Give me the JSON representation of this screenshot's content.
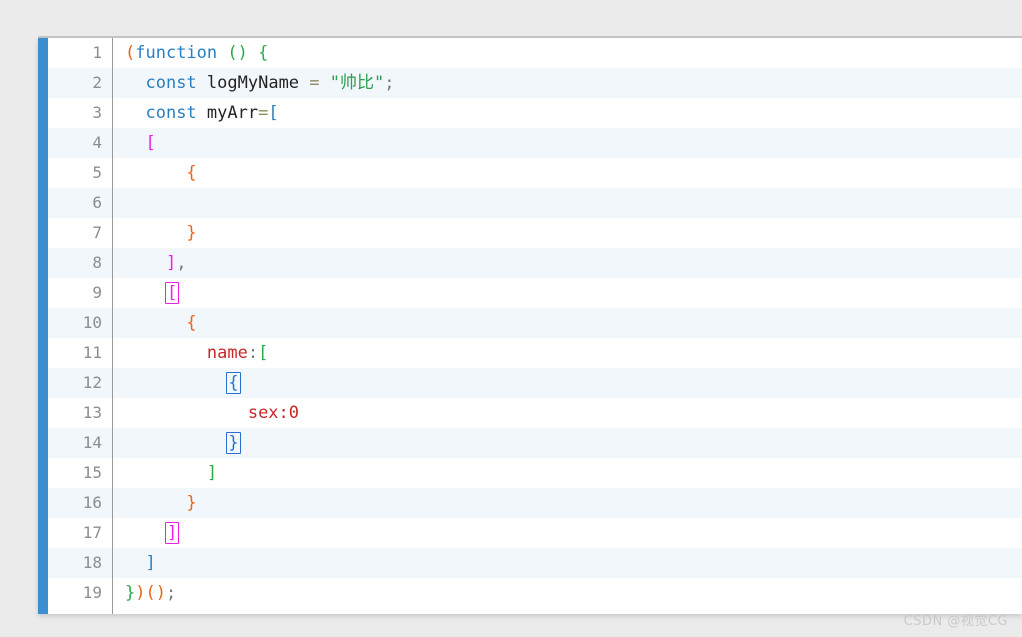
{
  "editor": {
    "accent_color": "#3b8fce",
    "background": "#ffffff",
    "alt_row_background": "#f2f7fb",
    "gutter_separator_color": "#9a9a9a",
    "line_count": 19,
    "lines": [
      {
        "number": "1",
        "text": "(function () {",
        "tokens": [
          {
            "text": "(",
            "color": "orange"
          },
          {
            "text": "function",
            "color": "kw"
          },
          {
            "text": " ",
            "color": "plain"
          },
          {
            "text": "()",
            "color": "green"
          },
          {
            "text": " ",
            "color": "plain"
          },
          {
            "text": "{",
            "color": "green"
          }
        ]
      },
      {
        "number": "2",
        "text": "  const logMyName = \"帅比\";",
        "tokens": [
          {
            "text": "  ",
            "color": "plain"
          },
          {
            "text": "const",
            "color": "kw"
          },
          {
            "text": " ",
            "color": "plain"
          },
          {
            "text": "logMyName",
            "color": "plain"
          },
          {
            "text": " ",
            "color": "plain"
          },
          {
            "text": "=",
            "color": "op"
          },
          {
            "text": " ",
            "color": "plain"
          },
          {
            "text": "\"帅比\"",
            "color": "str"
          },
          {
            "text": ";",
            "color": "gray"
          }
        ]
      },
      {
        "number": "3",
        "text": "  const myArr=[",
        "tokens": [
          {
            "text": "  ",
            "color": "plain"
          },
          {
            "text": "const",
            "color": "kw"
          },
          {
            "text": " ",
            "color": "plain"
          },
          {
            "text": "myArr",
            "color": "plain"
          },
          {
            "text": "=",
            "color": "op"
          },
          {
            "text": "[",
            "color": "blue"
          }
        ]
      },
      {
        "number": "4",
        "text": "  [",
        "tokens": [
          {
            "text": "  ",
            "color": "plain"
          },
          {
            "text": "[",
            "color": "magenta"
          }
        ]
      },
      {
        "number": "5",
        "text": "      {",
        "tokens": [
          {
            "text": "      ",
            "color": "plain"
          },
          {
            "text": "{",
            "color": "orange"
          }
        ]
      },
      {
        "number": "6",
        "text": "",
        "tokens": []
      },
      {
        "number": "7",
        "text": "      }",
        "tokens": [
          {
            "text": "      ",
            "color": "plain"
          },
          {
            "text": "}",
            "color": "orange"
          }
        ]
      },
      {
        "number": "8",
        "text": "    ],",
        "tokens": [
          {
            "text": "    ",
            "color": "plain"
          },
          {
            "text": "]",
            "color": "magenta"
          },
          {
            "text": ",",
            "color": "gray"
          }
        ]
      },
      {
        "number": "9",
        "text": "    [",
        "tokens": [
          {
            "text": "    ",
            "color": "plain"
          },
          {
            "text": "[",
            "color": "magenta",
            "box": "magenta"
          }
        ]
      },
      {
        "number": "10",
        "text": "      {",
        "tokens": [
          {
            "text": "      ",
            "color": "plain"
          },
          {
            "text": "{",
            "color": "orange"
          }
        ]
      },
      {
        "number": "11",
        "text": "        name:[",
        "tokens": [
          {
            "text": "        ",
            "color": "plain"
          },
          {
            "text": "name",
            "color": "red"
          },
          {
            "text": ":",
            "color": "gray"
          },
          {
            "text": "[",
            "color": "green"
          }
        ]
      },
      {
        "number": "12",
        "text": "          {",
        "tokens": [
          {
            "text": "          ",
            "color": "plain"
          },
          {
            "text": "{",
            "color": "blue",
            "box": "blue"
          }
        ]
      },
      {
        "number": "13",
        "text": "            sex:0",
        "tokens": [
          {
            "text": "            ",
            "color": "plain"
          },
          {
            "text": "sex:0",
            "color": "red"
          }
        ]
      },
      {
        "number": "14",
        "text": "          }",
        "tokens": [
          {
            "text": "          ",
            "color": "plain"
          },
          {
            "text": "}",
            "color": "blue",
            "box": "blue"
          }
        ]
      },
      {
        "number": "15",
        "text": "        ]",
        "tokens": [
          {
            "text": "        ",
            "color": "plain"
          },
          {
            "text": "]",
            "color": "green"
          }
        ]
      },
      {
        "number": "16",
        "text": "      }",
        "tokens": [
          {
            "text": "      ",
            "color": "plain"
          },
          {
            "text": "}",
            "color": "orange"
          }
        ]
      },
      {
        "number": "17",
        "text": "    ]",
        "tokens": [
          {
            "text": "    ",
            "color": "plain"
          },
          {
            "text": "]",
            "color": "magenta",
            "box": "magenta"
          }
        ]
      },
      {
        "number": "18",
        "text": "  ]",
        "tokens": [
          {
            "text": "  ",
            "color": "plain"
          },
          {
            "text": "]",
            "color": "blue"
          }
        ]
      },
      {
        "number": "19",
        "text": "})();",
        "tokens": [
          {
            "text": "}",
            "color": "green"
          },
          {
            "text": ")",
            "color": "orange"
          },
          {
            "text": "(",
            "color": "orange"
          },
          {
            "text": ")",
            "color": "orange"
          },
          {
            "text": ";",
            "color": "gray"
          }
        ]
      }
    ]
  },
  "watermark": {
    "text": "CSDN @视觉CG"
  }
}
